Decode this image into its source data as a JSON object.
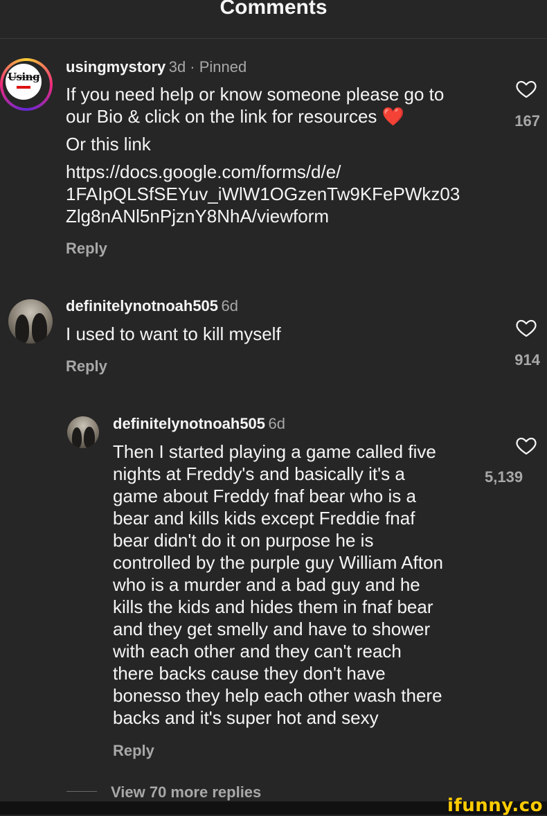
{
  "header": {
    "title": "Comments"
  },
  "comments": [
    {
      "username": "usingmystory",
      "meta": "3d · Pinned",
      "avatar_text": "Using",
      "lines": [
        "If you need help or know someone please go to",
        "our Bio & click on the link for resources ❤️",
        "Or this link",
        "https://docs.google.com/forms/d/e/",
        "1FAIpQLSfSEYuv_iWlW1OGzenTw9KFePWkz03",
        "Zlg8nANl5nPjznY8NhA/viewform"
      ],
      "reply": "Reply",
      "likes": "167"
    },
    {
      "username": "definitelynotnoah505",
      "meta": "6d",
      "lines": [
        "I used to want to kill myself"
      ],
      "reply": "Reply",
      "likes": "914"
    },
    {
      "username": "definitelynotnoah505",
      "meta": "6d",
      "lines": [
        "Then I started playing a game called five",
        "nights at Freddy's and basically it's a",
        "game about Freddy fnaf bear who is a",
        "bear and kills kids except Freddie fnaf",
        "bear didn't do it on purpose he is",
        "controlled by the purple guy William Afton",
        "who is a murder and a bad guy and he",
        "kills the kids and hides them in fnaf bear",
        "and they get smelly and have to shower",
        "with each other and they can't reach",
        "there backs cause they don't have",
        "bonesso they help each other wash there",
        "backs and it's super hot and sexy"
      ],
      "reply": "Reply",
      "likes": "5,139"
    }
  ],
  "view_more": "View 70 more replies",
  "brand": "ifunny.co"
}
